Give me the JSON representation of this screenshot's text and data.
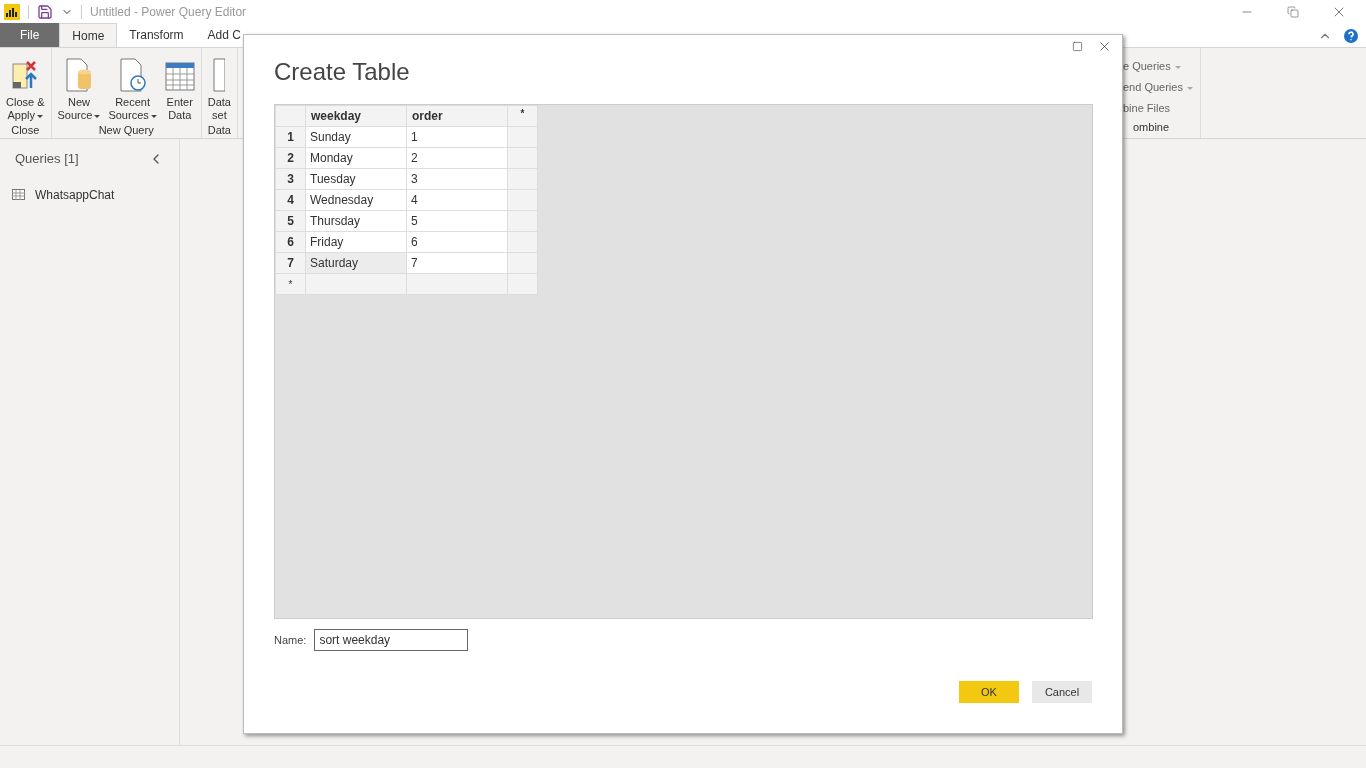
{
  "window": {
    "title": "Untitled - Power Query Editor"
  },
  "tabs": [
    {
      "label": "File",
      "kind": "file",
      "selected": false
    },
    {
      "label": "Home",
      "kind": "tab",
      "selected": true
    },
    {
      "label": "Transform",
      "kind": "tab",
      "selected": false
    },
    {
      "label": "Add C",
      "kind": "tab",
      "selected": false
    }
  ],
  "ribbon": {
    "groups": [
      {
        "label": "Close",
        "buttons": [
          {
            "label": "Close &",
            "label2": "Apply",
            "dropdown": true
          }
        ]
      },
      {
        "label": "New Query",
        "buttons": [
          {
            "label": "New",
            "label2": "Source",
            "dropdown": true
          },
          {
            "label": "Recent",
            "label2": "Sources",
            "dropdown": true
          },
          {
            "label": "Enter",
            "label2": "Data",
            "dropdown": false
          }
        ]
      },
      {
        "label": "Data",
        "buttons": [
          {
            "label": "Data",
            "label2": "set",
            "dropdown": false
          }
        ]
      }
    ],
    "combine_items": [
      {
        "label": "e Queries",
        "dropdown": true
      },
      {
        "label": "end Queries",
        "dropdown": true
      },
      {
        "label": "bine Files",
        "dropdown": false
      }
    ],
    "combine_label": "ombine"
  },
  "queries": {
    "title": "Queries [1]",
    "items": [
      {
        "label": "WhatsappChat"
      }
    ]
  },
  "dialog": {
    "title": "Create Table",
    "columns": [
      "weekday",
      "order"
    ],
    "new_column": "*",
    "rows": [
      {
        "number": "1",
        "cells": [
          "Sunday",
          "1"
        ],
        "selected": false
      },
      {
        "number": "2",
        "cells": [
          "Monday",
          "2"
        ],
        "selected": false
      },
      {
        "number": "3",
        "cells": [
          "Tuesday",
          "3"
        ],
        "selected": false
      },
      {
        "number": "4",
        "cells": [
          "Wednesday",
          "4"
        ],
        "selected": false
      },
      {
        "number": "5",
        "cells": [
          "Thursday",
          "5"
        ],
        "selected": false
      },
      {
        "number": "6",
        "cells": [
          "Friday",
          "6"
        ],
        "selected": false
      },
      {
        "number": "7",
        "cells": [
          "Saturday",
          "7"
        ],
        "selected": true
      }
    ],
    "new_row": "*",
    "name_label": "Name:",
    "name_value": "sort weekday",
    "buttons": [
      {
        "label": "OK",
        "kind": "primary"
      },
      {
        "label": "Cancel",
        "kind": "secondary"
      }
    ]
  }
}
